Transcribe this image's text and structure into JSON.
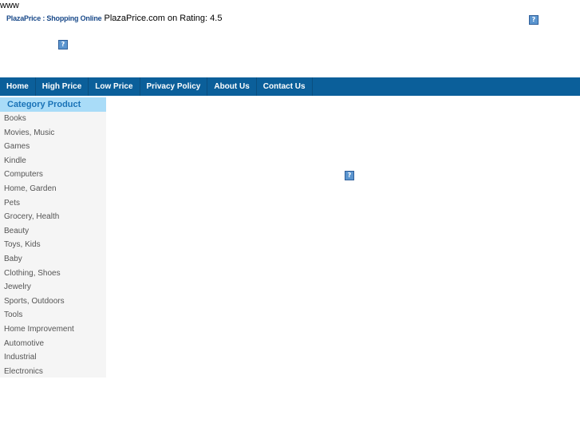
{
  "top_text": "www",
  "header": {
    "brand": "PlazaPrice : Shopping Online",
    "rating_text": "PlazaPrice.com on Rating: 4.5"
  },
  "nav": {
    "items": [
      "Home",
      "High Price",
      "Low Price",
      "Privacy Policy",
      "About Us",
      "Contact Us"
    ]
  },
  "sidebar": {
    "header": "Category Product",
    "items": [
      "Books",
      "Movies, Music",
      "Games",
      "Kindle",
      "Computers",
      "Home, Garden",
      "Pets",
      "Grocery, Health",
      "Beauty",
      "Toys, Kids",
      "Baby",
      "Clothing, Shoes",
      "Jewelry",
      "Sports, Outdoors",
      "Tools",
      "Home Improvement",
      "Automotive",
      "Industrial",
      "Electronics"
    ]
  },
  "icons": {
    "broken_image": "broken-image-icon"
  }
}
